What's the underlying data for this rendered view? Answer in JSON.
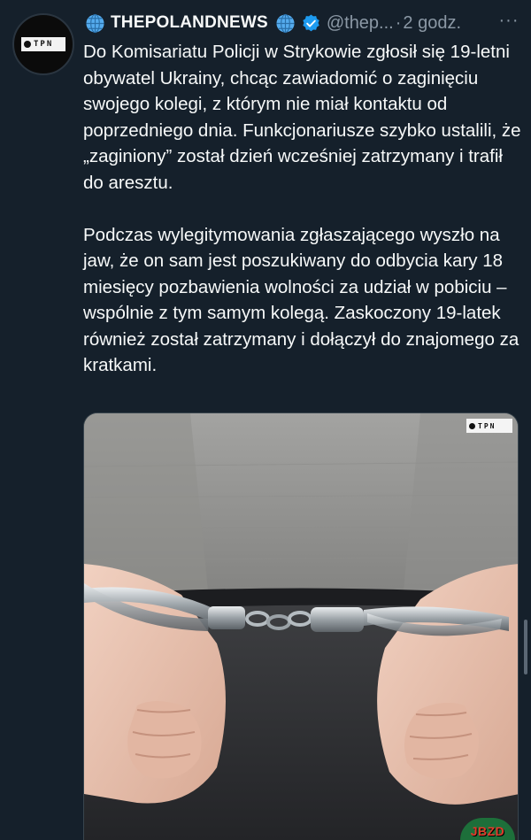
{
  "account": {
    "name": "THEPOLANDNEWS",
    "handle": "@thep...",
    "separator": "·",
    "time": "2 godz.",
    "avatar_text": "TPN"
  },
  "icons": {
    "globe": "globe-emoji-icon",
    "verified": "verified-badge-icon",
    "more": "more-options-icon"
  },
  "tweet": {
    "paragraph1": "Do Komisariatu Policji w Strykowie zgłosił się 19-letni obywatel Ukrainy, chcąc zawiadomić o zaginięciu swojego kolegi, z którym nie miał kontaktu od poprzedniego dnia. Funkcjonariusze szybko ustalili, że „zaginiony” został dzień wcześniej zatrzymany i trafił do aresztu.",
    "paragraph2": "Podczas wylegitymowania zgłaszającego wyszło na jaw, że on sam jest poszukiwany do odbycia kary 18 miesięcy pozbawienia wolności za udział w pobiciu – wspólnie z tym samym kolegą. Zaskoczony 19-latek również został zatrzymany i dołączył do znajomego za kratkami."
  },
  "media": {
    "watermark_text": "TPN"
  },
  "badge": {
    "text": "JBZD"
  },
  "colors": {
    "background": "#15202b",
    "text": "#f7f9f9",
    "secondary": "#8b98a5",
    "verified": "#1d9bf0"
  }
}
